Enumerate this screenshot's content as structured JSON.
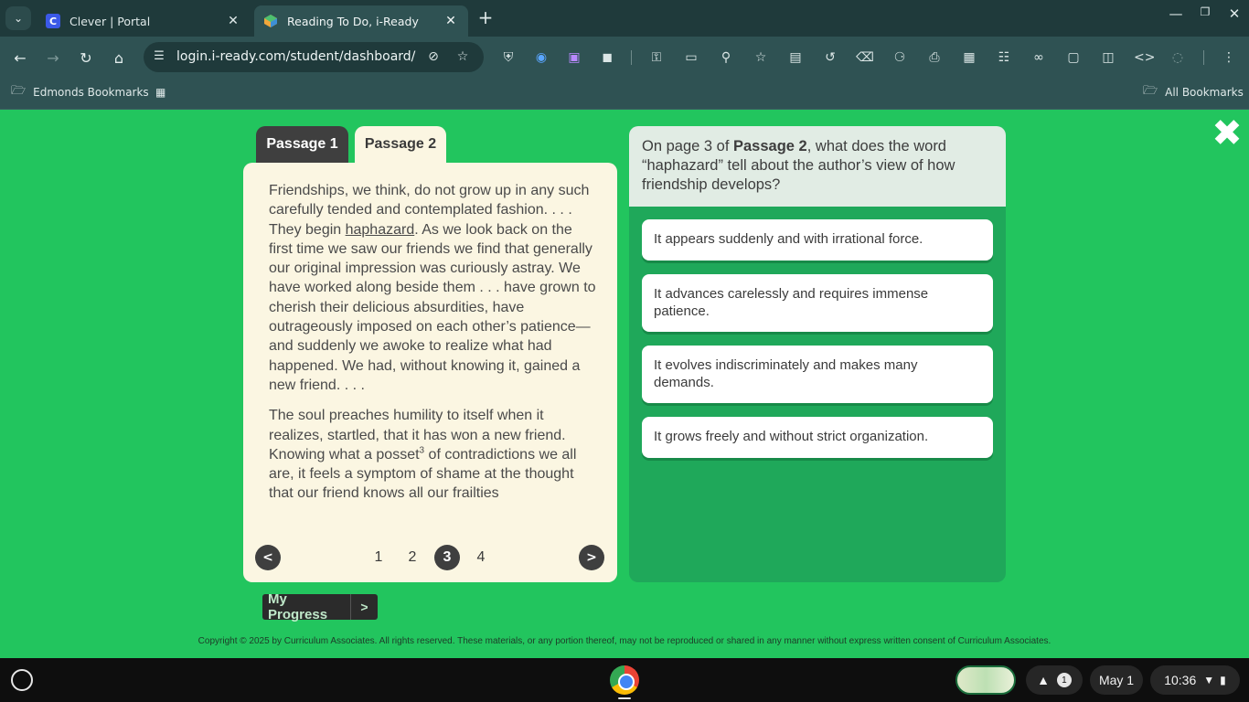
{
  "browser": {
    "tabs": [
      {
        "title": "Clever | Portal",
        "favicon": "C",
        "favicon_color": "#3b59e8"
      },
      {
        "title": "Reading To Do, i-Ready",
        "favicon": "",
        "favicon_color": "#f2a73b"
      }
    ],
    "url": "login.i-ready.com/student/dashboard/h...",
    "bookmarks": {
      "folder": "Edmonds Bookmarks",
      "all": "All Bookmarks"
    }
  },
  "passage": {
    "tabs": [
      "Passage 1",
      "Passage 2"
    ],
    "paragraph1_before": "Friendships, we think, do not grow up in any such carefully tended and contemplated fashion. . . . They begin ",
    "paragraph1_link": "haphazard",
    "paragraph1_after": ". As we look back on the first time we saw our friends we find that generally our original impression was curiously astray. We have worked along beside them . . . have grown to cherish their delicious absurdities, have outrageously imposed on each other’s patience—and suddenly we awoke to realize what had happened. We had, without knowing it, gained a new friend. . . .",
    "paragraph2_before": "The soul preaches humility to itself when it realizes, startled, that it has won a new friend. Knowing what a posset",
    "paragraph2_sup": "3",
    "paragraph2_after": " of contradictions we all are, it feels a symptom of shame at the thought that our friend knows all our frailties",
    "pager": {
      "prev": "<",
      "next": ">",
      "pages": [
        "1",
        "2",
        "3",
        "4"
      ],
      "current": 3
    }
  },
  "my_progress": {
    "label": "My Progress",
    "arrow": ">"
  },
  "question": {
    "prefix": "On page 3 of ",
    "bold": "Passage 2",
    "suffix": ", what does the word “haphazard” tell about the author’s view of how friendship develops?",
    "answers": [
      "It appears suddenly and with irrational force.",
      "It advances carelessly and requires immense patience.",
      "It evolves indiscriminately and makes many demands.",
      "It grows freely and without strict organization."
    ]
  },
  "copyright": "Copyright © 2025 by Curriculum Associates. All rights reserved. These materials, or any portion thereof, may not be reproduced or shared in any manner without express written consent of Curriculum Associates.",
  "shelf": {
    "notification_count": "1",
    "date": "May 1",
    "time": "10:36"
  },
  "colors": {
    "page_bg": "#22c55e",
    "passage_bg": "#fbf6e2",
    "question_bg": "#1fa85a",
    "dark_tab": "#3f3f3f"
  }
}
